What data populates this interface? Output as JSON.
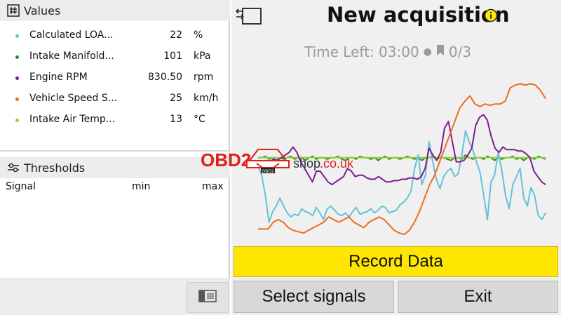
{
  "values": {
    "title": "Values",
    "items": [
      {
        "name": "Calculated LOA...",
        "value": "22",
        "unit": "%",
        "color": "#62c3d8"
      },
      {
        "name": "Intake Manifold...",
        "value": "101",
        "unit": "kPa",
        "color": "#2e8b2e"
      },
      {
        "name": "Engine RPM",
        "value": "830.50",
        "unit": "rpm",
        "color": "#7a1f8f"
      },
      {
        "name": "Vehicle Speed S...",
        "value": "25",
        "unit": "km/h",
        "color": "#f06a1e"
      },
      {
        "name": "Intake Air Temp...",
        "value": "13",
        "unit": "°C",
        "color": "#9acd32"
      }
    ]
  },
  "thresholds": {
    "title": "Thresholds",
    "columns": {
      "signal": "Signal",
      "min": "min",
      "max": "max"
    }
  },
  "acquisition": {
    "title": "New acquisition",
    "time_left": "Time Left: 03:00",
    "count": "0/3"
  },
  "buttons": {
    "record": "Record Data",
    "select": "Select signals",
    "exit": "Exit"
  },
  "watermark": {
    "text_a": "OBD2",
    "text_b": "shop",
    "text_c": ".co.uk",
    "badge": "OBD2"
  },
  "chart_data": {
    "type": "line",
    "series": [
      {
        "color": "#2e8b2e",
        "values": [
          58,
          58,
          59,
          57,
          58,
          56,
          58,
          57,
          58,
          59,
          57,
          58,
          58,
          56,
          58,
          59,
          57,
          58,
          58,
          57,
          58,
          58,
          59,
          57,
          56,
          58,
          58,
          57,
          59,
          58,
          58,
          57,
          58,
          56,
          58,
          59,
          57,
          58,
          58,
          57,
          58,
          59,
          58,
          57,
          58,
          56,
          58,
          58,
          59,
          57,
          58,
          58,
          57,
          56,
          58,
          58,
          57,
          60,
          58,
          57,
          58,
          58,
          57,
          59,
          58,
          56,
          58,
          57,
          58,
          58,
          59,
          57,
          58,
          56,
          58,
          58,
          57,
          59,
          58,
          57
        ]
      },
      {
        "color": "#9acd32",
        "values": [
          58,
          58,
          58,
          58,
          58,
          58,
          58,
          58,
          58,
          58,
          58,
          58,
          58,
          58,
          58,
          58,
          58,
          58,
          58,
          58,
          58,
          58,
          58,
          58,
          58,
          58,
          58,
          58,
          58,
          58,
          58,
          58,
          58,
          58,
          58,
          58,
          58,
          58,
          58,
          58,
          58,
          58,
          58,
          58,
          58,
          58,
          58,
          58,
          58,
          58,
          58,
          58,
          58,
          58,
          58,
          58,
          58,
          58,
          58,
          58,
          58,
          58,
          58,
          58,
          58,
          58,
          58,
          58,
          58,
          58,
          58,
          58,
          58,
          58,
          58,
          58,
          58,
          58,
          58,
          58
        ]
      },
      {
        "color": "#62c3d8",
        "values": [
          52,
          45,
          30,
          10,
          18,
          22,
          28,
          22,
          17,
          14,
          16,
          15,
          20,
          18,
          17,
          15,
          21,
          17,
          12,
          20,
          22,
          19,
          16,
          15,
          17,
          14,
          18,
          21,
          16,
          17,
          18,
          20,
          17,
          19,
          22,
          21,
          17,
          18,
          19,
          23,
          25,
          28,
          33,
          50,
          60,
          38,
          45,
          70,
          55,
          42,
          35,
          44,
          48,
          50,
          44,
          46,
          60,
          78,
          70,
          64,
          55,
          47,
          30,
          12,
          40,
          45,
          62,
          48,
          30,
          20,
          38,
          44,
          50,
          28,
          22,
          36,
          30,
          15,
          12,
          17
        ]
      },
      {
        "color": "#7a1f8f",
        "values": [
          53,
          54,
          56,
          55,
          57,
          56,
          58,
          60,
          62,
          66,
          62,
          55,
          50,
          45,
          40,
          48,
          48,
          44,
          40,
          38,
          40,
          42,
          44,
          50,
          48,
          44,
          45,
          45,
          43,
          42,
          42,
          44,
          42,
          40,
          40,
          41,
          41,
          42,
          42,
          43,
          43,
          42,
          44,
          50,
          65,
          60,
          56,
          62,
          80,
          85,
          70,
          55,
          55,
          56,
          60,
          65,
          82,
          88,
          90,
          86,
          74,
          65,
          62,
          66,
          64,
          64,
          64,
          63,
          63,
          61,
          58,
          48,
          44,
          40,
          38
        ]
      },
      {
        "color": "#f06a1e",
        "values": [
          5,
          5,
          5,
          10,
          12,
          10,
          6,
          4,
          3,
          2,
          4,
          6,
          8,
          10,
          14,
          12,
          10,
          12,
          14,
          10,
          8,
          6,
          10,
          12,
          14,
          12,
          8,
          4,
          2,
          1,
          4,
          10,
          18,
          28,
          38,
          45,
          55,
          65,
          75,
          85,
          95,
          100,
          104,
          98,
          96,
          98,
          97,
          98,
          98,
          100,
          110,
          112,
          113,
          112,
          113,
          112,
          108,
          102
        ]
      }
    ],
    "ylim": [
      0,
      120
    ]
  }
}
